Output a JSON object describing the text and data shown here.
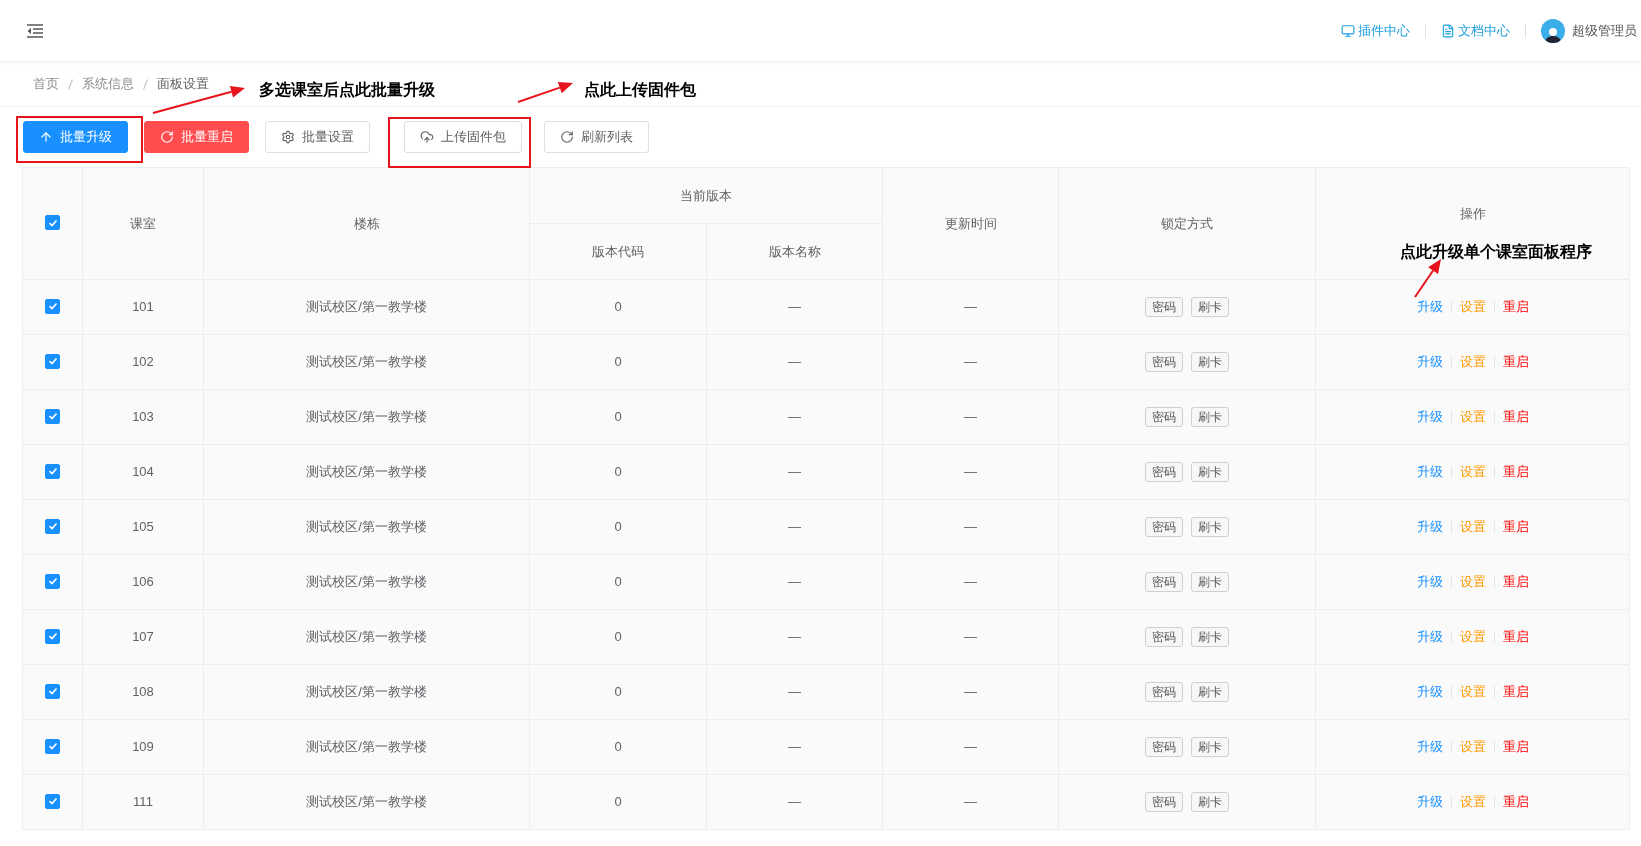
{
  "header": {
    "links": [
      {
        "label": "插件中心"
      },
      {
        "label": "文档中心"
      }
    ],
    "user": {
      "name": "超级管理员"
    }
  },
  "breadcrumb": [
    "首页",
    "系统信息",
    "面板设置"
  ],
  "toolbar": [
    {
      "label": "批量升级",
      "kind": "primary"
    },
    {
      "label": "批量重启",
      "kind": "danger"
    },
    {
      "label": "批量设置",
      "kind": "default"
    },
    {
      "label": "上传固件包",
      "kind": "default"
    },
    {
      "label": "刷新列表",
      "kind": "default"
    }
  ],
  "table": {
    "select_all_checked": true,
    "columns": {
      "room": "课室",
      "building": "楼栋",
      "version": "当前版本",
      "version_code": "版本代码",
      "version_name": "版本名称",
      "updated": "更新时间",
      "lock": "锁定方式",
      "actions": "操作"
    },
    "rows": [
      {
        "selected": true,
        "room": "101",
        "building": "测试校区/第一教学楼",
        "version_code": "0",
        "version_name": "—",
        "updated": "—",
        "locks": [
          "密码",
          "刷卡"
        ],
        "actions": [
          {
            "label": "升级",
            "kind": "upgrade"
          },
          {
            "label": "设置",
            "kind": "settings"
          },
          {
            "label": "重启",
            "kind": "restart"
          }
        ]
      },
      {
        "selected": true,
        "room": "102",
        "building": "测试校区/第一教学楼",
        "version_code": "0",
        "version_name": "—",
        "updated": "—",
        "locks": [
          "密码",
          "刷卡"
        ],
        "actions": [
          {
            "label": "升级",
            "kind": "upgrade"
          },
          {
            "label": "设置",
            "kind": "settings"
          },
          {
            "label": "重启",
            "kind": "restart"
          }
        ]
      },
      {
        "selected": true,
        "room": "103",
        "building": "测试校区/第一教学楼",
        "version_code": "0",
        "version_name": "—",
        "updated": "—",
        "locks": [
          "密码",
          "刷卡"
        ],
        "actions": [
          {
            "label": "升级",
            "kind": "upgrade"
          },
          {
            "label": "设置",
            "kind": "settings"
          },
          {
            "label": "重启",
            "kind": "restart"
          }
        ]
      },
      {
        "selected": true,
        "room": "104",
        "building": "测试校区/第一教学楼",
        "version_code": "0",
        "version_name": "—",
        "updated": "—",
        "locks": [
          "密码",
          "刷卡"
        ],
        "actions": [
          {
            "label": "升级",
            "kind": "upgrade"
          },
          {
            "label": "设置",
            "kind": "settings"
          },
          {
            "label": "重启",
            "kind": "restart"
          }
        ]
      },
      {
        "selected": true,
        "room": "105",
        "building": "测试校区/第一教学楼",
        "version_code": "0",
        "version_name": "—",
        "updated": "—",
        "locks": [
          "密码",
          "刷卡"
        ],
        "actions": [
          {
            "label": "升级",
            "kind": "upgrade"
          },
          {
            "label": "设置",
            "kind": "settings"
          },
          {
            "label": "重启",
            "kind": "restart"
          }
        ]
      },
      {
        "selected": true,
        "room": "106",
        "building": "测试校区/第一教学楼",
        "version_code": "0",
        "version_name": "—",
        "updated": "—",
        "locks": [
          "密码",
          "刷卡"
        ],
        "actions": [
          {
            "label": "升级",
            "kind": "upgrade"
          },
          {
            "label": "设置",
            "kind": "settings"
          },
          {
            "label": "重启",
            "kind": "restart"
          }
        ]
      },
      {
        "selected": true,
        "room": "107",
        "building": "测试校区/第一教学楼",
        "version_code": "0",
        "version_name": "—",
        "updated": "—",
        "locks": [
          "密码",
          "刷卡"
        ],
        "actions": [
          {
            "label": "升级",
            "kind": "upgrade"
          },
          {
            "label": "设置",
            "kind": "settings"
          },
          {
            "label": "重启",
            "kind": "restart"
          }
        ]
      },
      {
        "selected": true,
        "room": "108",
        "building": "测试校区/第一教学楼",
        "version_code": "0",
        "version_name": "—",
        "updated": "—",
        "locks": [
          "密码",
          "刷卡"
        ],
        "actions": [
          {
            "label": "升级",
            "kind": "upgrade"
          },
          {
            "label": "设置",
            "kind": "settings"
          },
          {
            "label": "重启",
            "kind": "restart"
          }
        ]
      },
      {
        "selected": true,
        "room": "109",
        "building": "测试校区/第一教学楼",
        "version_code": "0",
        "version_name": "—",
        "updated": "—",
        "locks": [
          "密码",
          "刷卡"
        ],
        "actions": [
          {
            "label": "升级",
            "kind": "upgrade"
          },
          {
            "label": "设置",
            "kind": "settings"
          },
          {
            "label": "重启",
            "kind": "restart"
          }
        ]
      },
      {
        "selected": true,
        "room": "111",
        "building": "测试校区/第一教学楼",
        "version_code": "0",
        "version_name": "—",
        "updated": "—",
        "locks": [
          "密码",
          "刷卡"
        ],
        "actions": [
          {
            "label": "升级",
            "kind": "upgrade"
          },
          {
            "label": "设置",
            "kind": "settings"
          },
          {
            "label": "重启",
            "kind": "restart"
          }
        ]
      }
    ]
  },
  "annotations": [
    "多选课室后点此批量升级",
    "点此上传固件包",
    "点此升级单个课室面板程序"
  ]
}
